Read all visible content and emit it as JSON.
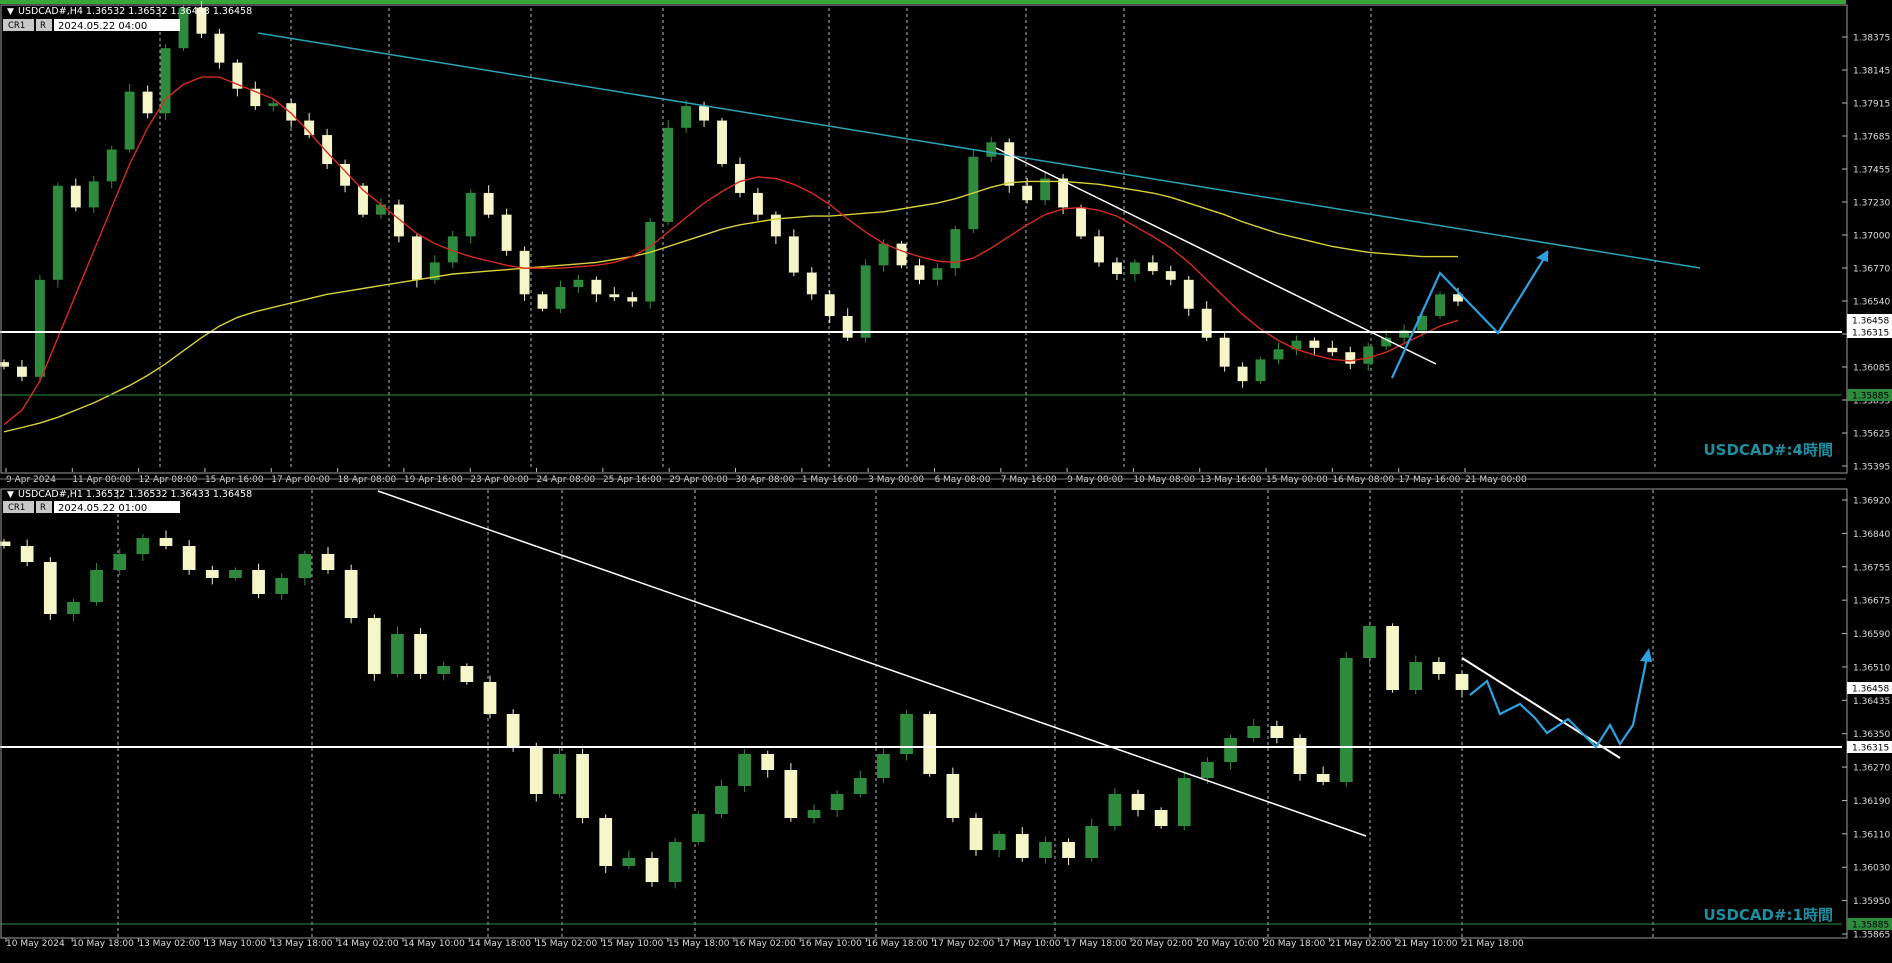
{
  "colors": {
    "background": "#000000",
    "candle": "#2e8b3e",
    "candle_light": "#f5f5c8",
    "grid": "#b9b9b9",
    "white_line": "#ffffff",
    "trendline": "#2aa3b8",
    "ma_red": "#d62b20",
    "ma_yellow": "#d8d23a",
    "projection": "#2ea1e0",
    "label_teal": "#1e8fa0",
    "support_green": "#2e8b3e",
    "top_border": "#3aa63a"
  },
  "panels": [
    {
      "id": "h4",
      "header": "USDCAD#,H4  1.36532 1.36532 1.36433 1.36458",
      "cr_label": "CR1",
      "r_label": "R",
      "timestamp": "2024.05.22 04:00",
      "watermark": "USDCAD#:4時間",
      "price_axis": [
        "1.38375",
        "1.38145",
        "1.37915",
        "1.37685",
        "1.37455",
        "1.37230",
        "1.37000",
        "1.36770",
        "1.36540",
        "1.36315",
        "1.36085",
        "1.35855",
        "1.35625",
        "1.35395"
      ],
      "current_price": "1.36458",
      "line_price": "1.36315",
      "support_price": "1.35885",
      "x_labels": [
        "9 Apr 2024",
        "11 Apr 00:00",
        "12 Apr 08:00",
        "15 Apr 16:00",
        "17 Apr 00:00",
        "18 Apr 08:00",
        "19 Apr 16:00",
        "23 Apr 00:00",
        "24 Apr 08:00",
        "25 Apr 16:00",
        "29 Apr 00:00",
        "30 Apr 08:00",
        "1 May 16:00",
        "3 May 00:00",
        "6 May 08:00",
        "7 May 16:00",
        "9 May 00:00",
        "10 May 08:00",
        "13 May 16:00",
        "15 May 00:00",
        "16 May 08:00",
        "17 May 16:00",
        "21 May 00:00"
      ],
      "y_range": [
        1.353,
        1.3845
      ],
      "closes": [
        1.36,
        1.3593,
        1.366,
        1.3725,
        1.371,
        1.3728,
        1.375,
        1.379,
        1.3775,
        1.382,
        1.3848,
        1.383,
        1.381,
        1.3792,
        1.378,
        1.3782,
        1.377,
        1.376,
        1.374,
        1.3725,
        1.3705,
        1.3712,
        1.369,
        1.366,
        1.3672,
        1.369,
        1.372,
        1.3705,
        1.368,
        1.365,
        1.364,
        1.3655,
        1.366,
        1.365,
        1.3648,
        1.3645,
        1.37,
        1.3765,
        1.378,
        1.377,
        1.374,
        1.372,
        1.3705,
        1.369,
        1.3665,
        1.365,
        1.3635,
        1.362,
        1.367,
        1.3685,
        1.367,
        1.366,
        1.3668,
        1.3695,
        1.3745,
        1.3755,
        1.3725,
        1.3715,
        1.373,
        1.371,
        1.369,
        1.3672,
        1.3664,
        1.3672,
        1.3666,
        1.366,
        1.364,
        1.362,
        1.36,
        1.359,
        1.3605,
        1.3612,
        1.3618,
        1.3613,
        1.361,
        1.3602,
        1.3614,
        1.362,
        1.3625,
        1.3635,
        1.365,
        1.3645
      ],
      "ma_red": [
        1.356,
        1.357,
        1.359,
        1.362,
        1.365,
        1.368,
        1.371,
        1.374,
        1.3765,
        1.3785,
        1.3795,
        1.38,
        1.38,
        1.3795,
        1.379,
        1.3785,
        1.3775,
        1.3762,
        1.3748,
        1.3735,
        1.3722,
        1.3712,
        1.3702,
        1.3692,
        1.3685,
        1.368,
        1.3676,
        1.3673,
        1.367,
        1.3668,
        1.3668,
        1.3668,
        1.3669,
        1.367,
        1.3672,
        1.3676,
        1.3683,
        1.3693,
        1.3703,
        1.3713,
        1.3721,
        1.3728,
        1.3731,
        1.373,
        1.3726,
        1.372,
        1.3712,
        1.3702,
        1.3693,
        1.3685,
        1.368,
        1.3676,
        1.3673,
        1.3672,
        1.3675,
        1.3682,
        1.369,
        1.3698,
        1.3705,
        1.3709,
        1.371,
        1.3708,
        1.3704,
        1.3697,
        1.369,
        1.3682,
        1.3672,
        1.366,
        1.3648,
        1.3636,
        1.3626,
        1.3618,
        1.3612,
        1.3608,
        1.3605,
        1.3604,
        1.3606,
        1.361,
        1.3616,
        1.3622,
        1.3628,
        1.3632
      ],
      "ma_yellow": [
        1.3555,
        1.3558,
        1.3561,
        1.3565,
        1.357,
        1.3575,
        1.3581,
        1.3587,
        1.3594,
        1.3602,
        1.3611,
        1.362,
        1.3628,
        1.3634,
        1.3638,
        1.3641,
        1.3644,
        1.3647,
        1.365,
        1.3652,
        1.3654,
        1.3656,
        1.3658,
        1.366,
        1.3662,
        1.3664,
        1.3665,
        1.3666,
        1.3667,
        1.3668,
        1.3669,
        1.367,
        1.3671,
        1.3672,
        1.3674,
        1.3676,
        1.3679,
        1.3683,
        1.3687,
        1.3691,
        1.3695,
        1.3698,
        1.37,
        1.3702,
        1.3703,
        1.3704,
        1.3704,
        1.3705,
        1.3706,
        1.3707,
        1.3709,
        1.3711,
        1.3713,
        1.3716,
        1.372,
        1.3724,
        1.3727,
        1.3728,
        1.3728,
        1.3728,
        1.3727,
        1.3726,
        1.3724,
        1.3722,
        1.372,
        1.3717,
        1.3713,
        1.3709,
        1.3705,
        1.37,
        1.3696,
        1.3692,
        1.3689,
        1.3686,
        1.3683,
        1.3681,
        1.3679,
        1.3678,
        1.3677,
        1.3676,
        1.3676,
        1.3676
      ]
    },
    {
      "id": "h1",
      "header": "USDCAD#,H1  1.36532 1.36532 1.36433 1.36458",
      "cr_label": "CR1",
      "r_label": "R",
      "timestamp": "2024.05.22 01:00",
      "watermark": "USDCAD#:1時間",
      "price_axis": [
        "1.36920",
        "1.36840",
        "1.36755",
        "1.36675",
        "1.36590",
        "1.36510",
        "1.36435",
        "1.36350",
        "1.36270",
        "1.36190",
        "1.36110",
        "1.36030",
        "1.35950",
        "1.35865"
      ],
      "current_price": "1.36458",
      "line_price": "1.36315",
      "support_price": "1.35885",
      "x_labels": [
        "10 May 2024",
        "10 May 18:00",
        "13 May 02:00",
        "13 May 10:00",
        "13 May 18:00",
        "14 May 02:00",
        "14 May 10:00",
        "14 May 18:00",
        "15 May 02:00",
        "15 May 10:00",
        "15 May 18:00",
        "16 May 02:00",
        "16 May 10:00",
        "16 May 18:00",
        "17 May 02:00",
        "17 May 10:00",
        "17 May 18:00",
        "20 May 02:00",
        "20 May 10:00",
        "20 May 18:00",
        "21 May 02:00",
        "21 May 10:00",
        "21 May 18:00"
      ],
      "y_range": [
        1.3584,
        1.3695
      ],
      "closes": [
        1.3682,
        1.3678,
        1.3665,
        1.3668,
        1.3676,
        1.368,
        1.3684,
        1.3682,
        1.3676,
        1.3674,
        1.3676,
        1.367,
        1.3674,
        1.368,
        1.3676,
        1.3664,
        1.365,
        1.366,
        1.365,
        1.3652,
        1.3648,
        1.364,
        1.3632,
        1.362,
        1.363,
        1.3614,
        1.3602,
        1.3604,
        1.3598,
        1.3608,
        1.3615,
        1.3622,
        1.363,
        1.3626,
        1.3614,
        1.3616,
        1.362,
        1.3624,
        1.363,
        1.364,
        1.3625,
        1.3614,
        1.3606,
        1.361,
        1.3604,
        1.3608,
        1.3604,
        1.3612,
        1.362,
        1.3616,
        1.3612,
        1.3624,
        1.3628,
        1.3634,
        1.3637,
        1.3634,
        1.3625,
        1.3623,
        1.3654,
        1.3662,
        1.3646,
        1.3653,
        1.365,
        1.3646
      ]
    }
  ]
}
